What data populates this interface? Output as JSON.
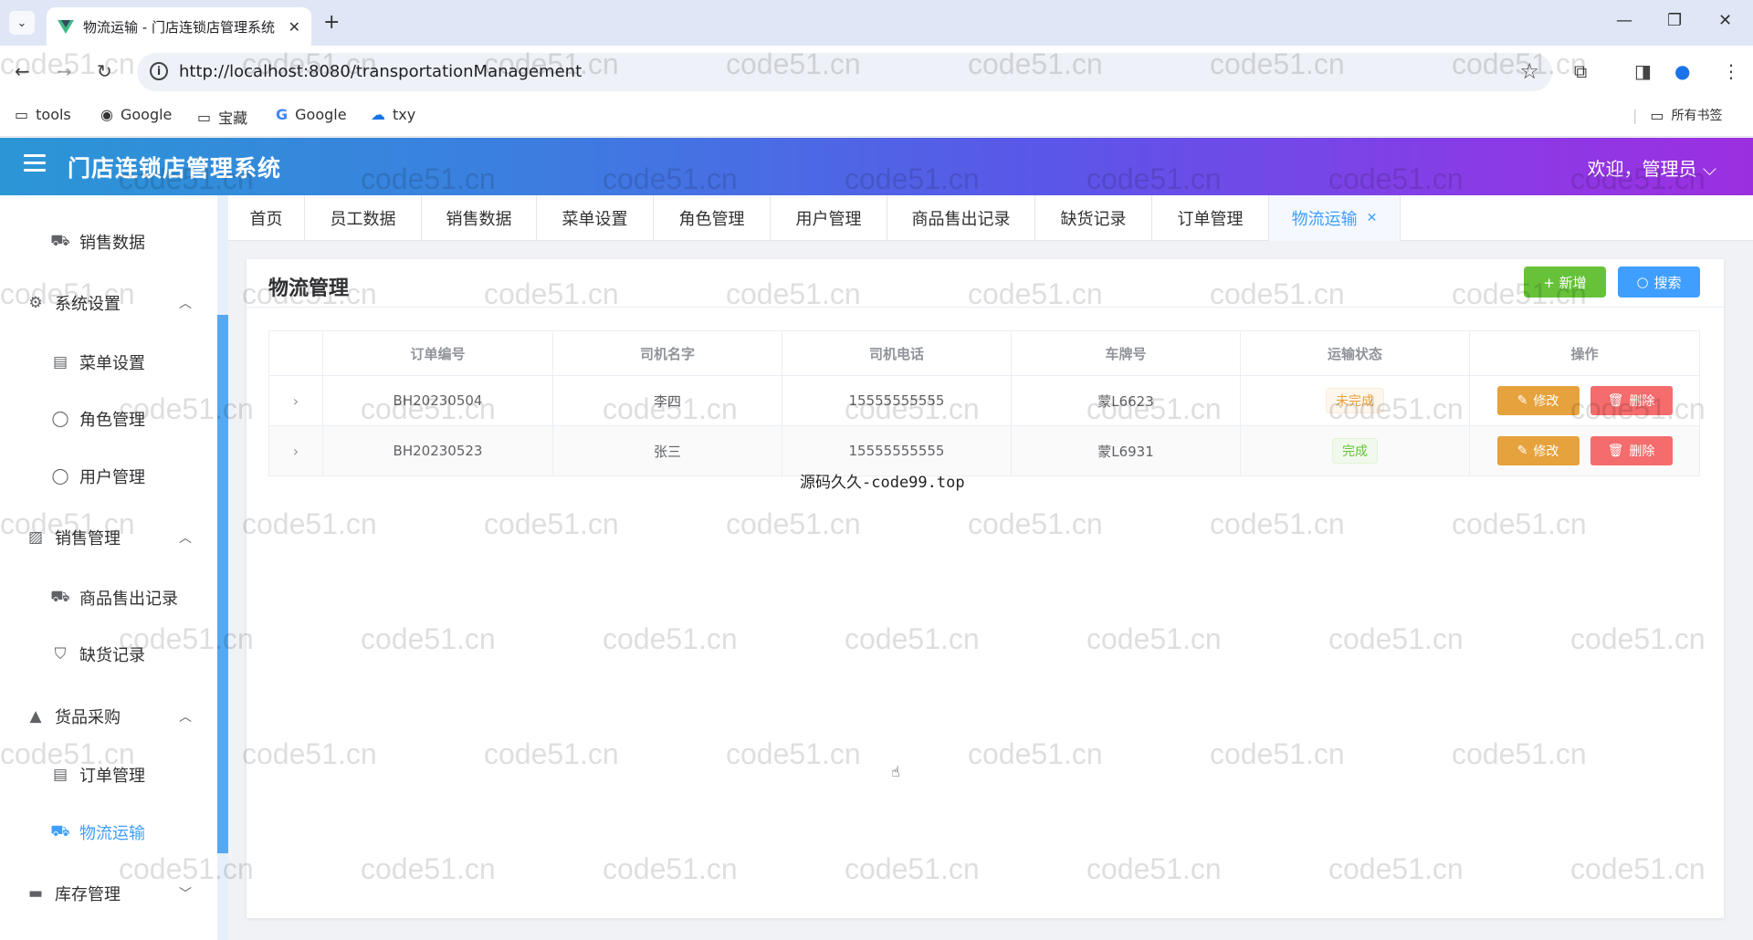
{
  "browser": {
    "tab_title": "物流运输 - 门店连锁店管理系统",
    "url": "http://localhost:8080/transportationManagement",
    "bookmarks": [
      "tools",
      "Google",
      "宝藏",
      "Google",
      "txy"
    ],
    "all_bookmarks": "所有书签"
  },
  "header": {
    "title": "门店连锁店管理系统",
    "welcome": "欢迎，管理员"
  },
  "sidebar": {
    "items": [
      {
        "label": "销售数据",
        "icon": "truck-icon",
        "type": "sub"
      },
      {
        "label": "系统设置",
        "icon": "gear-icon",
        "type": "group"
      },
      {
        "label": "菜单设置",
        "icon": "document-icon",
        "type": "sub"
      },
      {
        "label": "角色管理",
        "icon": "user-icon",
        "type": "sub"
      },
      {
        "label": "用户管理",
        "icon": "user-icon",
        "type": "sub"
      },
      {
        "label": "销售管理",
        "icon": "chart-icon",
        "type": "group"
      },
      {
        "label": "商品售出记录",
        "icon": "truck-icon",
        "type": "sub"
      },
      {
        "label": "缺货记录",
        "icon": "bag-icon",
        "type": "sub"
      },
      {
        "label": "货品采购",
        "icon": "shop-icon",
        "type": "group"
      },
      {
        "label": "订单管理",
        "icon": "document-icon",
        "type": "sub"
      },
      {
        "label": "物流运输",
        "icon": "truck-icon",
        "type": "sub"
      },
      {
        "label": "库存管理",
        "icon": "box-icon",
        "type": "group"
      }
    ]
  },
  "tags": [
    "首页",
    "员工数据",
    "销售数据",
    "菜单设置",
    "角色管理",
    "用户管理",
    "商品售出记录",
    "缺货记录",
    "订单管理",
    "物流运输"
  ],
  "main": {
    "title": "物流管理",
    "add_label": "+ 新增",
    "search_label": "搜索",
    "columns": [
      "订单编号",
      "司机名字",
      "司机电话",
      "车牌号",
      "运输状态",
      "操作"
    ],
    "rows": [
      {
        "order": "BH20230504",
        "driver": "李四",
        "phone": "15555555555",
        "plate": "蒙L6623",
        "status": "未完成"
      },
      {
        "order": "BH20230523",
        "driver": "张三",
        "phone": "15555555555",
        "plate": "蒙L6931",
        "status": "完成"
      }
    ],
    "edit_label": "修改",
    "delete_label": "删除"
  },
  "overlay": "源码久久-code99.top",
  "watermark": "code51.cn",
  "colors": {
    "primary": "#409eff",
    "success": "#67c23a",
    "warning": "#e6a23c",
    "danger": "#f56c6c"
  }
}
